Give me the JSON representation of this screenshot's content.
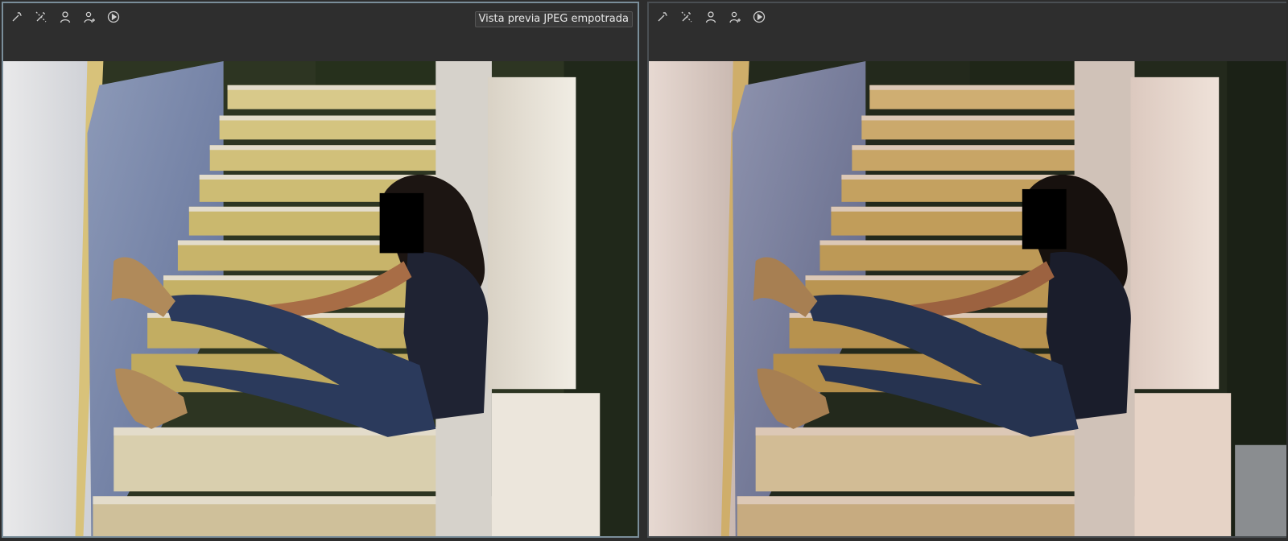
{
  "left_pane": {
    "tools": [
      {
        "icon": "magic-wand-icon"
      },
      {
        "icon": "magic-wand-off-icon"
      },
      {
        "icon": "person-icon"
      },
      {
        "icon": "person-add-icon"
      },
      {
        "icon": "play-icon"
      }
    ],
    "preview_label": "Vista previa JPEG empotrada"
  },
  "right_pane": {
    "tools": [
      {
        "icon": "magic-wand-icon"
      },
      {
        "icon": "magic-wand-off-icon"
      },
      {
        "icon": "person-icon"
      },
      {
        "icon": "person-add-icon"
      },
      {
        "icon": "play-icon"
      }
    ]
  },
  "colors": {
    "active_border": "#7a8e9a",
    "toolbar_bg": "#2e2e2e",
    "icon_color": "#cfcfcf"
  }
}
